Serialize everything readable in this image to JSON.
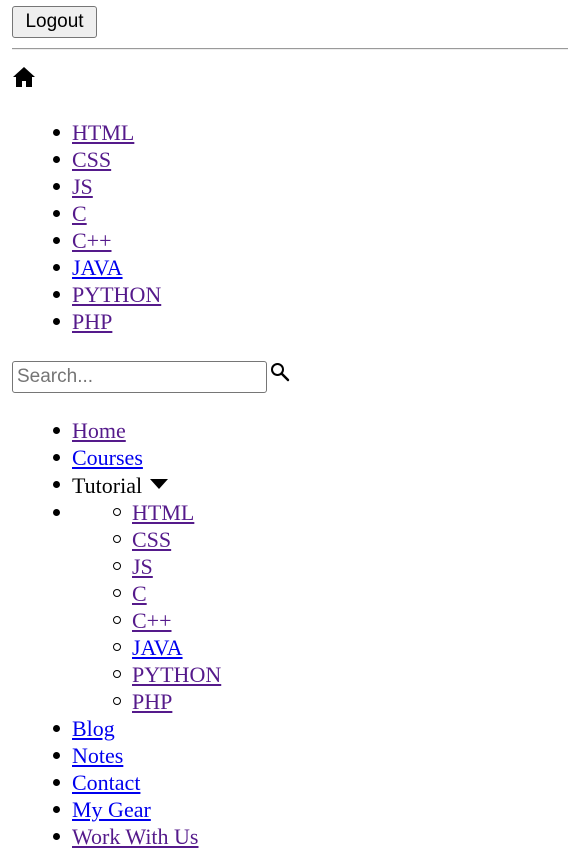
{
  "header": {
    "logout_label": "Logout",
    "home_icon": "home-icon"
  },
  "languages": [
    {
      "label": "HTML"
    },
    {
      "label": "CSS"
    },
    {
      "label": "JS"
    },
    {
      "label": "C"
    },
    {
      "label": "C++"
    },
    {
      "label": "JAVA"
    },
    {
      "label": "PYTHON"
    },
    {
      "label": "PHP"
    }
  ],
  "search": {
    "placeholder": "Search...",
    "value": "",
    "icon": "search-icon"
  },
  "nav": {
    "home": "Home",
    "courses": "Courses",
    "tutorial": "Tutorial",
    "tutorial_icon": "caret-down-icon",
    "tutorial_items": [
      {
        "label": "HTML"
      },
      {
        "label": "CSS"
      },
      {
        "label": "JS"
      },
      {
        "label": "C"
      },
      {
        "label": "C++"
      },
      {
        "label": "JAVA"
      },
      {
        "label": "PYTHON"
      },
      {
        "label": "PHP"
      }
    ],
    "blog": "Blog",
    "notes": "Notes",
    "contact": "Contact",
    "my_gear": "My Gear",
    "work_with_us": "Work With Us"
  },
  "colors": {
    "link_visited": "#551a8b",
    "link_unvisited": "#0000ee",
    "button_bg": "#efefef"
  }
}
